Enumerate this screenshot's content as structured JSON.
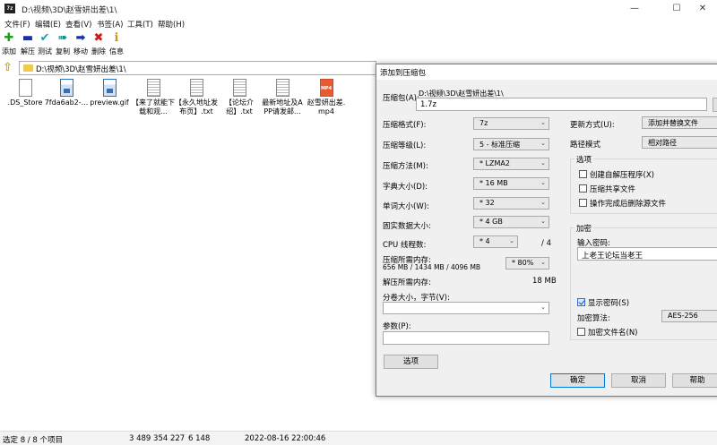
{
  "window": {
    "title": "D:\\视频\\3D\\赵雪妍出差\\1\\",
    "app_icon_text": "7z",
    "controls": {
      "minimize": "—",
      "maximize": "☐",
      "close": "✕"
    }
  },
  "menu": [
    "文件(F)",
    "编辑(E)",
    "查看(V)",
    "书签(A)",
    "工具(T)",
    "帮助(H)"
  ],
  "toolbar": [
    {
      "label": "添加",
      "icon": "add-plus-icon",
      "glyph": "✚",
      "color": "#1ea01e"
    },
    {
      "label": "解压",
      "icon": "extract-minus-icon",
      "glyph": "▬",
      "color": "#1a2fa8"
    },
    {
      "label": "测试",
      "icon": "test-check-icon",
      "glyph": "✔",
      "color": "#1aa0a8"
    },
    {
      "label": "复制",
      "icon": "copy-arrows-icon",
      "glyph": "➠",
      "color": "#18908a"
    },
    {
      "label": "移动",
      "icon": "move-arrow-icon",
      "glyph": "➡",
      "color": "#1a2fa8"
    },
    {
      "label": "删除",
      "icon": "delete-x-icon",
      "glyph": "✖",
      "color": "#d01818"
    },
    {
      "label": "信息",
      "icon": "info-icon",
      "glyph": "ℹ",
      "color": "#c89a00"
    }
  ],
  "path": "D:\\视频\\3D\\赵雪妍出差\\1\\",
  "files": [
    {
      "name": ".DS_Store",
      "type": "blank"
    },
    {
      "name": "7fda6ab2-...",
      "type": "gif"
    },
    {
      "name": "preview.gif",
      "type": "gif"
    },
    {
      "name": "【来了就能下载和观...",
      "type": "txt"
    },
    {
      "name": "【永久地址发布页】.txt",
      "type": "txt"
    },
    {
      "name": "【论坛介绍】.txt",
      "type": "txt"
    },
    {
      "name": "最新地址及APP请发邮...",
      "type": "txt"
    },
    {
      "name": "赵雪妍出差.mp4",
      "type": "mp4",
      "badge": "MP4"
    }
  ],
  "status": {
    "selected": "选定 8 / 8 个项目",
    "size": "3 489 354 227",
    "packed": "6 148",
    "modified": "2022-08-16 22:00:46"
  },
  "dialog": {
    "title": "添加到压缩包",
    "archive_label": "压缩包(A):",
    "archive_path": "D:\\视频\\3D\\赵雪妍出差\\1\\",
    "archive_name": "1.7z",
    "format_label": "压缩格式(F):",
    "format_value": "7z",
    "level_label": "压缩等级(L):",
    "level_value": "5 - 标准压缩",
    "method_label": "压缩方法(M):",
    "method_value": "* LZMA2",
    "dict_label": "字典大小(D):",
    "dict_value": "* 16 MB",
    "word_label": "单词大小(W):",
    "word_value": "* 32",
    "solid_label": "固实数据大小:",
    "solid_value": "* 4 GB",
    "cpu_label": "CPU 线程数:",
    "cpu_value": "* 4",
    "cpu_total": "/ 4",
    "mem_comp_label": "压缩所需内存:",
    "mem_comp_detail": "656 MB / 1434 MB / 4096 MB",
    "mem_comp_value": "* 80%",
    "mem_decomp_label": "解压所需内存:",
    "mem_decomp_value": "18 MB",
    "split_label": "分卷大小，字节(V):",
    "params_label": "参数(P):",
    "options_button": "选项",
    "update_label": "更新方式(U):",
    "update_value": "添加并替换文件",
    "pathmode_label": "路径模式",
    "pathmode_value": "相对路径",
    "options_group": "选项",
    "opt_sfx": "创建自解压程序(X)",
    "opt_shared": "压缩共享文件",
    "opt_delete": "操作完成后删除源文件",
    "encrypt_group": "加密",
    "password_label": "输入密码:",
    "password_value": "上老王论坛当老王",
    "show_password": "显示密码(S)",
    "enc_method_label": "加密算法:",
    "enc_method_value": "AES-256",
    "enc_names": "加密文件名(N)",
    "ok": "确定",
    "cancel": "取消",
    "help": "帮助"
  }
}
